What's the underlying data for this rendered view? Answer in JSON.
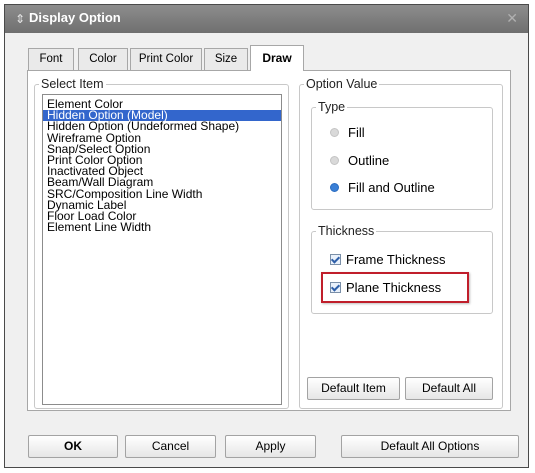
{
  "window": {
    "title": "Display Option",
    "title_icon": "⇕",
    "close_glyph": "✕"
  },
  "tabs": [
    {
      "label": "Font",
      "active": false
    },
    {
      "label": "Color",
      "active": false
    },
    {
      "label": "Print Color",
      "active": false
    },
    {
      "label": "Size",
      "active": false
    },
    {
      "label": "Draw",
      "active": true
    }
  ],
  "select_item": {
    "legend": "Select Item",
    "items": [
      "Element Color",
      "Hidden Option (Model)",
      "Hidden Option (Undeformed Shape)",
      "Wireframe Option",
      "Snap/Select Option",
      "Print Color Option",
      "Inactivated Object",
      "Beam/Wall Diagram",
      "SRC/Composition Line Width",
      "Dynamic Label",
      "Floor Load Color",
      "Element Line Width"
    ],
    "selected": "Hidden Option (Model)"
  },
  "option_value": {
    "legend": "Option Value",
    "type": {
      "legend": "Type",
      "options": [
        "Fill",
        "Outline",
        "Fill and Outline"
      ],
      "selected": "Fill and Outline"
    },
    "thickness": {
      "legend": "Thickness",
      "frame_label": "Frame Thickness",
      "frame_checked": true,
      "plane_label": "Plane Thickness",
      "plane_checked": true
    },
    "default_item_label": "Default Item",
    "default_all_label": "Default All"
  },
  "footer": {
    "ok_label": "OK",
    "cancel_label": "Cancel",
    "apply_label": "Apply",
    "default_all_options_label": "Default All Options"
  },
  "colors": {
    "selection": "#3366cc",
    "highlight_border": "#c01e2b",
    "radio_on": "#3a7fd6"
  }
}
